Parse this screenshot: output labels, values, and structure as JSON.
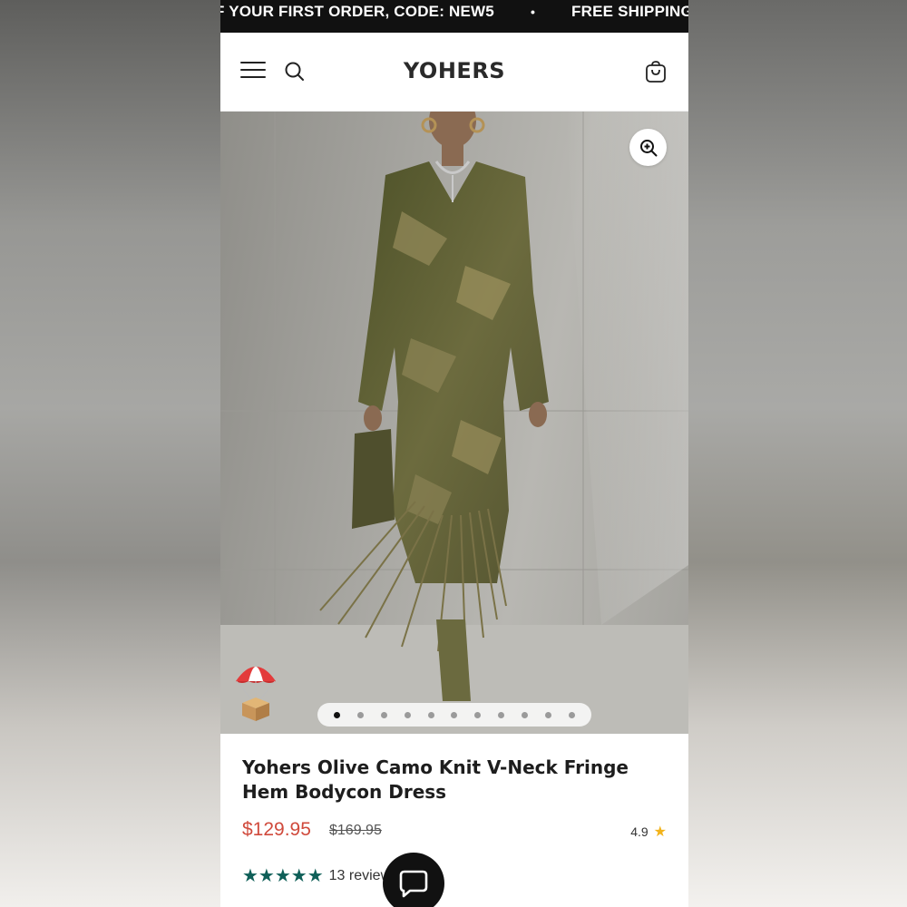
{
  "announcement": {
    "text_1": "F YOUR FIRST ORDER, CODE: NEW5",
    "separator": "•",
    "text_2": "FREE SHIPPING O"
  },
  "header": {
    "logo": "YOHERS",
    "menu_icon": "hamburger-menu-icon",
    "search_icon": "search-icon",
    "cart_icon": "shopping-bag-icon"
  },
  "gallery": {
    "image_count": 11,
    "active_index": 0,
    "zoom_icon": "zoom-in-icon",
    "promo_icon": "parachute-box-icon"
  },
  "product": {
    "title": "Yohers Olive Camo Knit V-Neck Fringe Hem Bodycon Dress",
    "price": "$129.95",
    "compare_price": "$169.95",
    "rating": "4.9",
    "rating_star": "★",
    "stars": "★★★★★",
    "star_count": 5,
    "reviews": "13 reviews"
  },
  "chat": {
    "icon": "chat-bubble-icon"
  },
  "colors": {
    "price": "#d04a3c",
    "review_stars": "#0f5f58",
    "rating_star": "#f2b31b",
    "announcement_bg": "#111111"
  }
}
